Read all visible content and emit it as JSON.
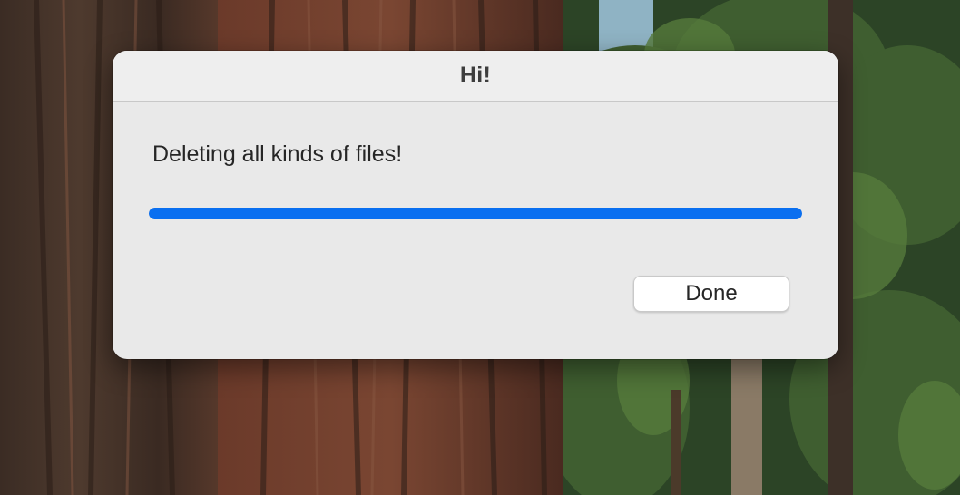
{
  "dialog": {
    "title": "Hi!",
    "message": "Deleting all kinds of files!",
    "progress": 1.0,
    "accent_color": "#0a6ff0",
    "done_label": "Done"
  },
  "wallpaper": {
    "description_icon": "forest-wallpaper"
  }
}
